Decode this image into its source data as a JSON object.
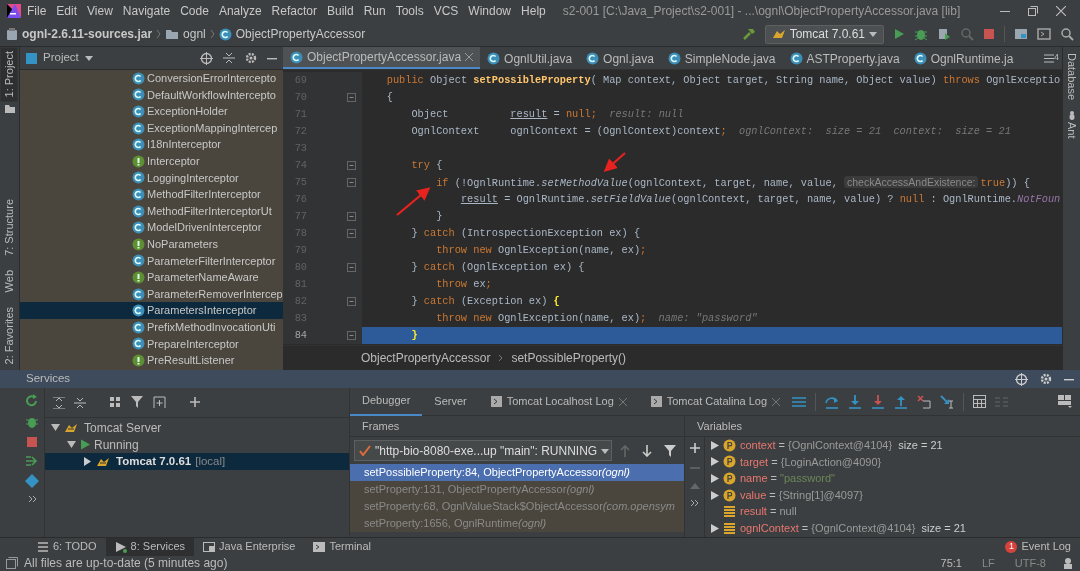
{
  "menu": {
    "items": [
      "File",
      "Edit",
      "View",
      "Navigate",
      "Code",
      "Analyze",
      "Refactor",
      "Build",
      "Run",
      "Tools",
      "VCS",
      "Window",
      "Help"
    ],
    "title": "s2-001 [C:\\Java_Project\\s2-001] - ...\\ognl\\ObjectPropertyAccessor.java [lib]"
  },
  "navbar": {
    "crumbs": [
      {
        "kind": "jar",
        "text": "ognl-2.6.11-sources.jar"
      },
      {
        "kind": "folder",
        "text": "ognl"
      },
      {
        "kind": "class",
        "text": "ObjectPropertyAccessor"
      }
    ],
    "run_config": "Tomcat 7.0.61"
  },
  "left_stripe": {
    "top": [
      {
        "text": "1: Project",
        "selected": true
      }
    ],
    "bottom": [
      {
        "text": "7: Structure",
        "selected": false
      },
      {
        "text": "Web",
        "selected": false
      },
      {
        "text": "2: Favorites",
        "selected": false
      }
    ]
  },
  "right_stripe": [
    "Database",
    "Ant"
  ],
  "project": {
    "title": "Project",
    "items": [
      {
        "text": "ConversionErrorIntercepto",
        "kind": "class",
        "selected": false
      },
      {
        "text": "DefaultWorkflowIntercepto",
        "kind": "class",
        "selected": false
      },
      {
        "text": "ExceptionHolder",
        "kind": "class",
        "selected": false
      },
      {
        "text": "ExceptionMappingIntercep",
        "kind": "class",
        "selected": false
      },
      {
        "text": "I18nInterceptor",
        "kind": "class",
        "selected": false
      },
      {
        "text": "Interceptor",
        "kind": "interface",
        "selected": false
      },
      {
        "text": "LoggingInterceptor",
        "kind": "class",
        "selected": false
      },
      {
        "text": "MethodFilterInterceptor",
        "kind": "class",
        "selected": false
      },
      {
        "text": "MethodFilterInterceptorUt",
        "kind": "class",
        "selected": false
      },
      {
        "text": "ModelDrivenInterceptor",
        "kind": "class",
        "selected": false
      },
      {
        "text": "NoParameters",
        "kind": "interface",
        "selected": false
      },
      {
        "text": "ParameterFilterInterceptor",
        "kind": "class",
        "selected": false
      },
      {
        "text": "ParameterNameAware",
        "kind": "interface",
        "selected": false
      },
      {
        "text": "ParameterRemoverIntercep",
        "kind": "class",
        "selected": false
      },
      {
        "text": "ParametersInterceptor",
        "kind": "class",
        "selected": true
      },
      {
        "text": "PrefixMethodInvocationUti",
        "kind": "class",
        "selected": false
      },
      {
        "text": "PrepareInterceptor",
        "kind": "class",
        "selected": false
      },
      {
        "text": "PreResultListener",
        "kind": "interface",
        "selected": false
      }
    ]
  },
  "editor": {
    "tabs": [
      {
        "text": "ObjectPropertyAccessor.java",
        "selected": true
      },
      {
        "text": "OgnlUtil.java",
        "selected": false
      },
      {
        "text": "Ognl.java",
        "selected": false
      },
      {
        "text": "SimpleNode.java",
        "selected": false
      },
      {
        "text": "ASTProperty.java",
        "selected": false
      },
      {
        "text": "OgnlRuntime.ja",
        "selected": false
      }
    ],
    "hidden_tabs": "4",
    "lines": [
      {
        "number": "69",
        "fold": false,
        "current": false,
        "tokens": [
          {
            "kind": "keyword",
            "text": "    public "
          },
          {
            "kind": "plain",
            "text": "Object "
          },
          {
            "kind": "declaration",
            "text": "setPossibleProperty"
          },
          {
            "kind": "plain",
            "text": "( Map context, Object target, String name, Object value) "
          },
          {
            "kind": "keyword",
            "text": "throws "
          },
          {
            "kind": "plain",
            "text": "OgnlExceptio"
          }
        ]
      },
      {
        "number": "70",
        "fold": true,
        "current": false,
        "tokens": [
          {
            "kind": "plain",
            "text": "    {"
          }
        ]
      },
      {
        "number": "71",
        "fold": false,
        "current": false,
        "tokens": [
          {
            "kind": "plain",
            "text": "        Object          "
          },
          {
            "kind": "reassigned",
            "text": "result"
          },
          {
            "kind": "plain",
            "text": " = "
          },
          {
            "kind": "keyword",
            "text": "null"
          },
          {
            "kind": "keyword",
            "text": ";"
          },
          {
            "kind": "debug-value",
            "text": "  result: null"
          }
        ]
      },
      {
        "number": "72",
        "fold": false,
        "current": false,
        "tokens": [
          {
            "kind": "plain",
            "text": "        OgnlContext     ognlContext = (OgnlContext)context"
          },
          {
            "kind": "keyword",
            "text": ";"
          },
          {
            "kind": "debug-value",
            "text": "  ognlContext:  size = 21  context:  size = 21"
          }
        ]
      },
      {
        "number": "73",
        "fold": false,
        "current": false
      },
      {
        "number": "74",
        "fold": true,
        "current": false,
        "tokens": [
          {
            "kind": "keyword",
            "text": "        try "
          },
          {
            "kind": "plain",
            "text": "{"
          }
        ]
      },
      {
        "number": "75",
        "fold": true,
        "current": false,
        "tokens": [
          {
            "kind": "keyword",
            "text": "            if "
          },
          {
            "kind": "plain",
            "text": "(!OgnlRuntime."
          },
          {
            "kind": "static-call",
            "text": "setMethodValue"
          },
          {
            "kind": "plain",
            "text": "(ognlContext, target, name, value, "
          },
          {
            "kind": "param-hint",
            "text": "checkAccessAndExistence:"
          },
          {
            "kind": "keyword",
            "text": "true"
          },
          {
            "kind": "plain",
            "text": ")) {"
          }
        ]
      },
      {
        "number": "76",
        "fold": false,
        "current": false,
        "tokens": [
          {
            "kind": "reassigned",
            "text": "                result"
          },
          {
            "kind": "plain",
            "text": " = OgnlRuntime."
          },
          {
            "kind": "static-call",
            "text": "setFieldValue"
          },
          {
            "kind": "plain",
            "text": "(ognlContext, target, name, value) ? "
          },
          {
            "kind": "keyword",
            "text": "null "
          },
          {
            "kind": "plain",
            "text": ": OgnlRuntime."
          },
          {
            "kind": "constant",
            "text": "NotFoun"
          }
        ]
      },
      {
        "number": "77",
        "fold": true,
        "current": false,
        "tokens": [
          {
            "kind": "plain",
            "text": "            }"
          }
        ]
      },
      {
        "number": "78",
        "fold": true,
        "current": false,
        "tokens": [
          {
            "kind": "plain",
            "text": "        } "
          },
          {
            "kind": "keyword",
            "text": "catch "
          },
          {
            "kind": "plain",
            "text": "(IntrospectionException ex) {"
          }
        ]
      },
      {
        "number": "79",
        "fold": false,
        "current": false,
        "tokens": [
          {
            "kind": "keyword",
            "text": "            throw new "
          },
          {
            "kind": "plain",
            "text": "OgnlException(name, ex)"
          },
          {
            "kind": "keyword",
            "text": ";"
          }
        ]
      },
      {
        "number": "80",
        "fold": true,
        "current": false,
        "tokens": [
          {
            "kind": "plain",
            "text": "        } "
          },
          {
            "kind": "keyword",
            "text": "catch "
          },
          {
            "kind": "plain",
            "text": "(OgnlException ex) {"
          }
        ]
      },
      {
        "number": "81",
        "fold": false,
        "current": false,
        "tokens": [
          {
            "kind": "keyword",
            "text": "            throw "
          },
          {
            "kind": "plain",
            "text": "ex"
          },
          {
            "kind": "keyword",
            "text": ";"
          }
        ]
      },
      {
        "number": "82",
        "fold": true,
        "current": false,
        "tokens": [
          {
            "kind": "plain",
            "text": "        } "
          },
          {
            "kind": "keyword",
            "text": "catch "
          },
          {
            "kind": "plain",
            "text": "(Exception ex) "
          },
          {
            "kind": "brace-match",
            "text": "{"
          }
        ]
      },
      {
        "number": "83",
        "fold": false,
        "current": false,
        "tokens": [
          {
            "kind": "keyword",
            "text": "            throw new "
          },
          {
            "kind": "plain",
            "text": "OgnlException(name, ex)"
          },
          {
            "kind": "keyword",
            "text": ";"
          },
          {
            "kind": "debug-value",
            "text": "  name: \"password\""
          }
        ]
      },
      {
        "number": "84",
        "fold": true,
        "current": true,
        "tokens": [
          {
            "kind": "brace-match",
            "text": "        }"
          }
        ]
      }
    ],
    "breadcrumbs": [
      "ObjectPropertyAccessor",
      "setPossibleProperty()"
    ]
  },
  "services": {
    "title": "Services",
    "tree": [
      {
        "text": "Tomcat Server",
        "kind": "server",
        "expanded": true,
        "selected": false,
        "children": [
          {
            "text": "Running",
            "kind": "status",
            "expanded": true,
            "selected": false,
            "children": [
              {
                "text": "Tomcat 7.0.61",
                "note": "[local]",
                "kind": "server",
                "expanded": false,
                "selected": true
              }
            ]
          }
        ]
      }
    ],
    "tabs": [
      {
        "text": "Debugger",
        "selected": true,
        "closable": false
      },
      {
        "text": "Server",
        "selected": false,
        "closable": false
      },
      {
        "text": "Tomcat Localhost Log",
        "selected": false,
        "closable": true
      },
      {
        "text": "Tomcat Catalina Log",
        "selected": false,
        "closable": true
      }
    ],
    "frames_title": "Frames",
    "thread": "\"http-bio-8080-exe...up \"main\": RUNNING",
    "frames": [
      {
        "method": "setPossibleProperty:84, ObjectPropertyAccessor",
        "package": "(ognl)",
        "selected": true
      },
      {
        "method": "setProperty:131, ObjectPropertyAccessor",
        "package": "(ognl)",
        "selected": false
      },
      {
        "method": "setProperty:68, OgnlValueStack$ObjectAccessor",
        "package": "(com.opensym",
        "selected": false
      },
      {
        "method": "setProperty:1656, OgnlRuntime",
        "package": "(ognl)",
        "selected": false
      }
    ],
    "variables_title": "Variables",
    "variables": [
      {
        "kind": "param",
        "name": "context",
        "separator": "=",
        "value": "{OgnlContext@4104}",
        "extra": "size = 21",
        "quoted": false,
        "expandable": true
      },
      {
        "kind": "param",
        "name": "target",
        "separator": "=",
        "value": "{LoginAction@4090}",
        "quoted": false,
        "expandable": true
      },
      {
        "kind": "param",
        "name": "name",
        "separator": "=",
        "value": "\"password\"",
        "quoted": true,
        "expandable": true
      },
      {
        "kind": "param",
        "name": "value",
        "separator": "=",
        "value": "{String[1]@4097}",
        "quoted": false,
        "expandable": true
      },
      {
        "kind": "local",
        "name": "result",
        "separator": "=",
        "value": "null",
        "quoted": false,
        "expandable": false
      },
      {
        "kind": "local",
        "name": "ognlContext",
        "separator": "=",
        "value": "{OgnlContext@4104}",
        "extra": "size = 21",
        "quoted": false,
        "expandable": true
      }
    ]
  },
  "tool_tabs": [
    {
      "text": "6: TODO",
      "kind": "todo",
      "selected": false
    },
    {
      "text": "8: Services",
      "kind": "services",
      "selected": true
    },
    {
      "text": "Java Enterprise",
      "kind": "enterprise",
      "selected": false
    },
    {
      "text": "Terminal",
      "kind": "terminal",
      "selected": false
    }
  ],
  "event_log": {
    "text": "Event Log",
    "count": "1"
  },
  "status": {
    "message": "All files are up-to-date (5 minutes ago)",
    "position": "75:1",
    "line_separator": "LF",
    "encoding": "UTF-8"
  }
}
